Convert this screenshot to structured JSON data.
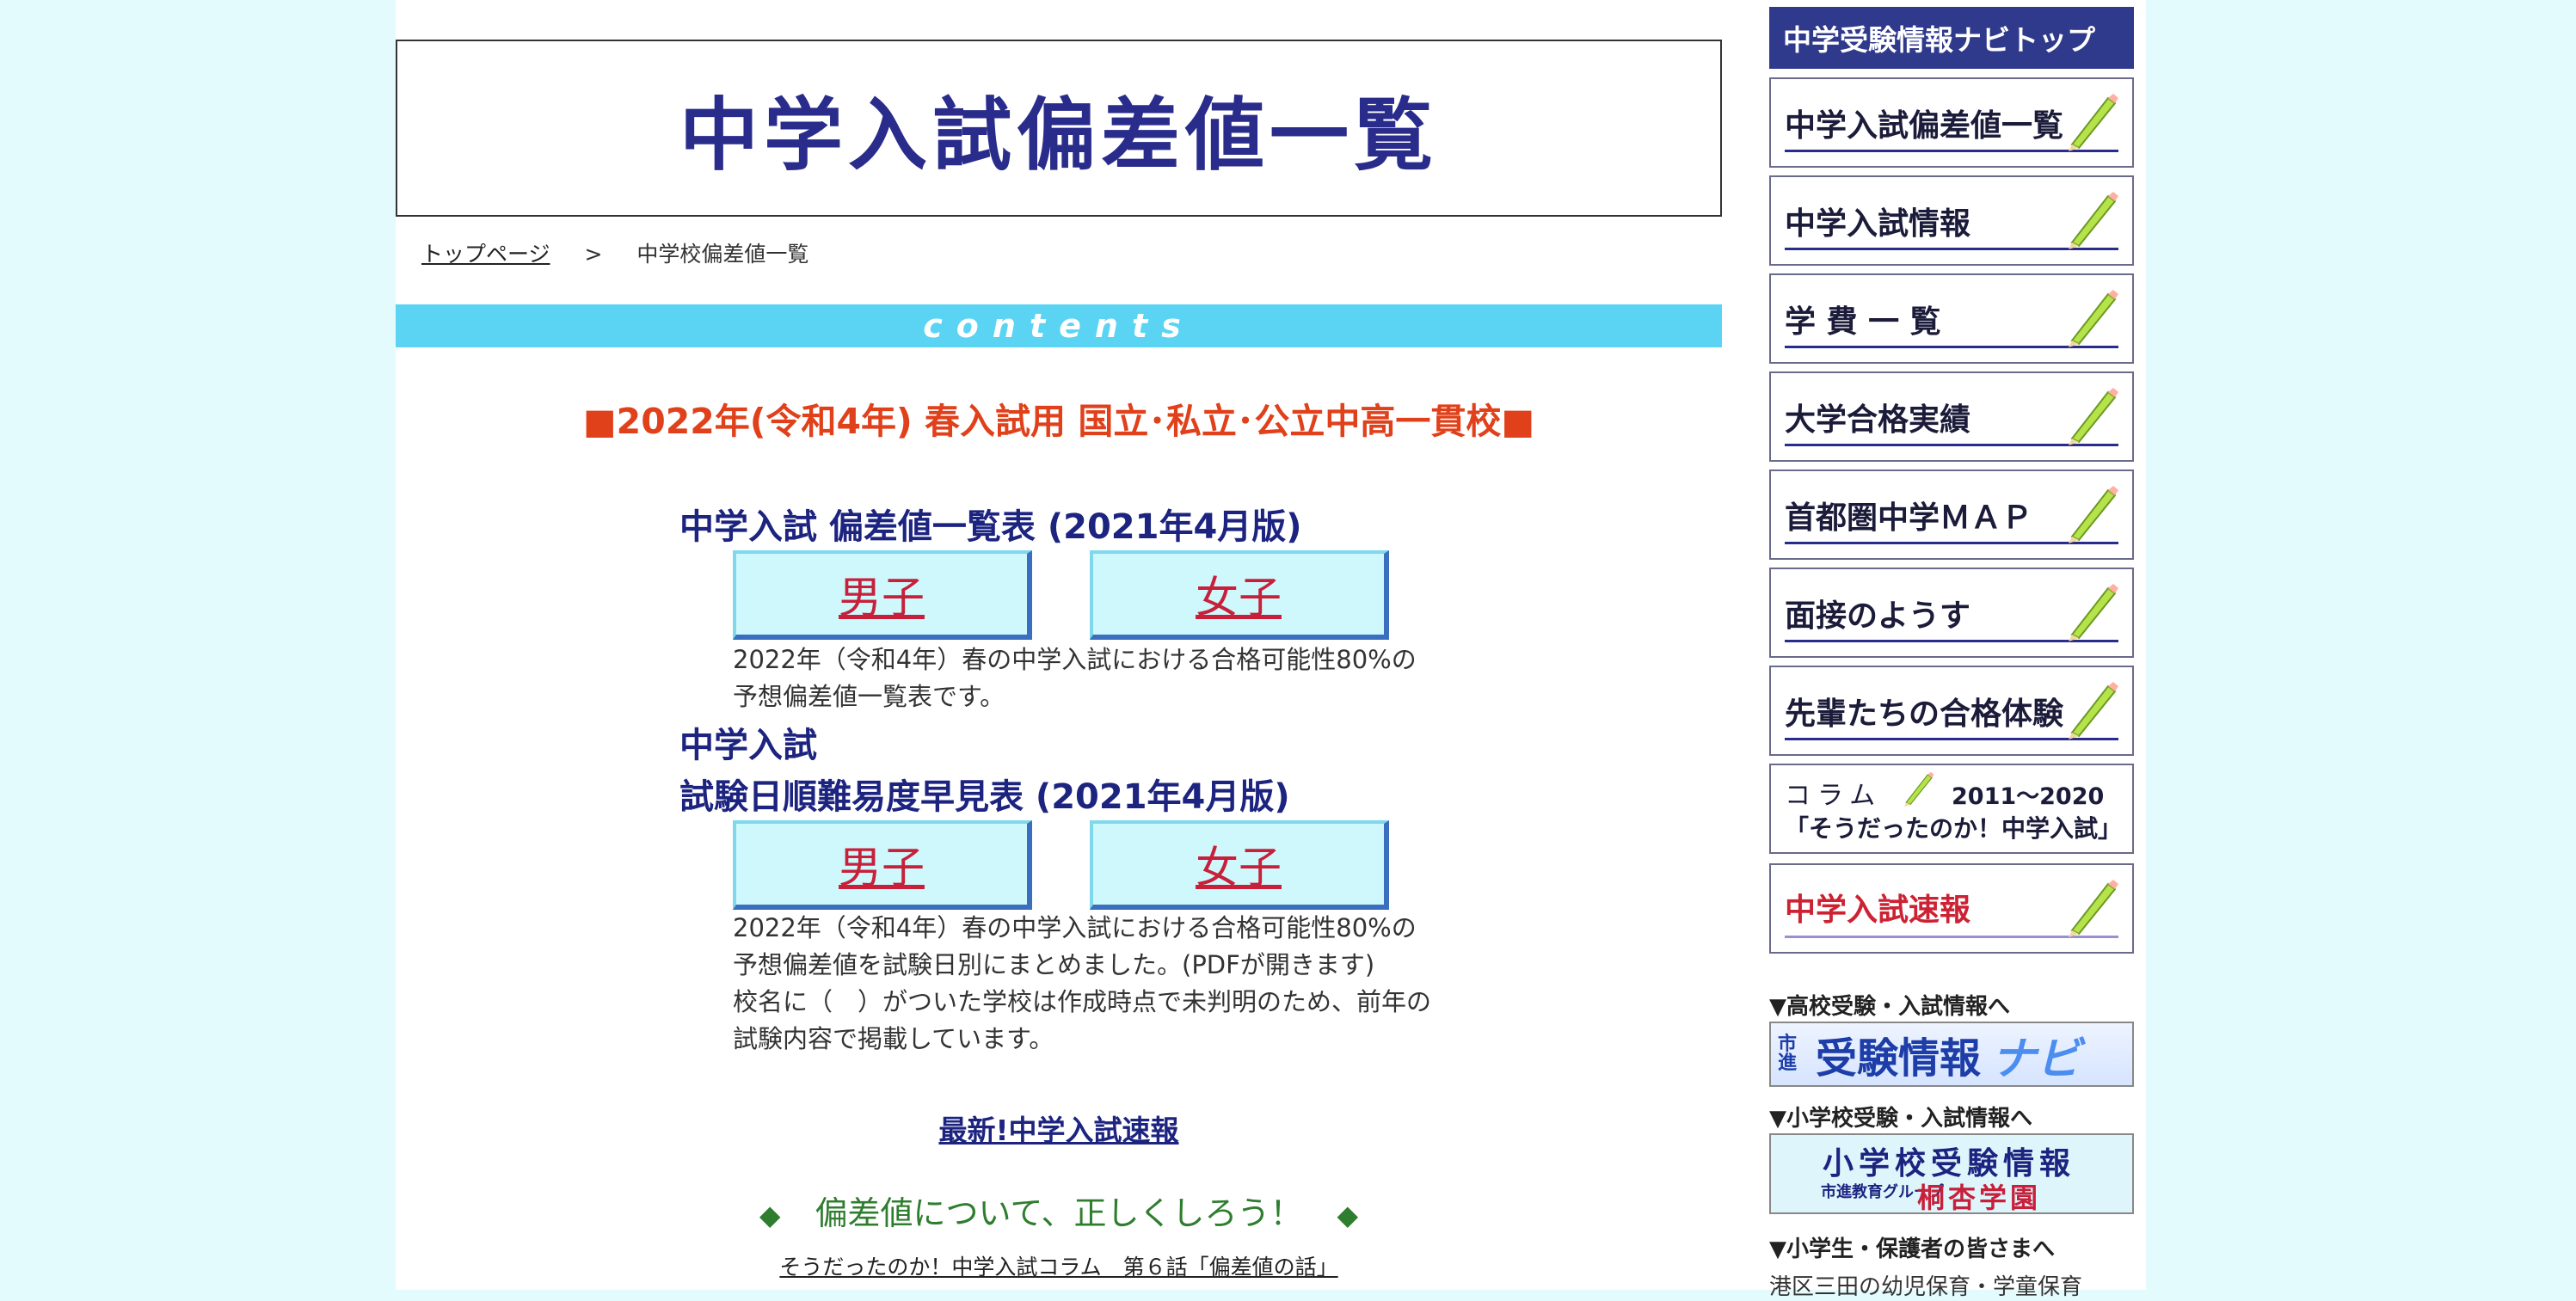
{
  "header": {
    "title": "中学入試偏差値一覧"
  },
  "breadcrumb": {
    "home": "トップページ",
    "separator": ">",
    "current": "中学校偏差値一覧"
  },
  "contents_label": "contents",
  "exam_title": "■2022年(令和4年) 春入試用 国立･私立･公立中高一貫校■",
  "section1": {
    "title": "中学入試 偏差値一覧表 (2021年4月版)",
    "boys": "男子",
    "girls": "女子",
    "note_line1": "2022年（令和4年）春の中学入試における合格可能性80%の",
    "note_line2": "予想偏差値一覧表です。"
  },
  "section2": {
    "title_line1": "中学入試",
    "title_line2": "試験日順難易度早見表 (2021年4月版)",
    "boys": "男子",
    "girls": "女子",
    "note_line1": "2022年（令和4年）春の中学入試における合格可能性80%の",
    "note_line2": "予想偏差値を試験日別にまとめました。(PDFが開きます)",
    "note_line3": "校名に（　）がついた学校は作成時点で未判明のため、前年の",
    "note_line4": "試験内容で掲載しています。"
  },
  "news_link": "最新!中学入試速報",
  "hensa": {
    "diamond": "◆",
    "heading": "偏差値について、正しくしろう！"
  },
  "column_link": "そうだったのか！中学入試コラム　第６話「偏差値の話」",
  "sidebar": {
    "top": "中学受験情報ナビトップ",
    "items": [
      {
        "label": "中学入試偏差値一覧"
      },
      {
        "label": "中学入試情報"
      },
      {
        "label": "学 費 一 覧"
      },
      {
        "label": "大学合格実績"
      },
      {
        "label": "首都圏中学ＭＡＰ"
      },
      {
        "label": "面接のようす"
      },
      {
        "label": "先輩たちの合格体験"
      }
    ],
    "column": {
      "top": "コラム",
      "years": "2011〜2020",
      "sub": "「そうだったのか！中学入試」"
    },
    "sokuho": "中学入試速報",
    "caption_koko": "▼高校受験・入試情報へ",
    "banner_koko": {
      "brand": "市進",
      "main": "受験情報",
      "navi": "ナビ"
    },
    "caption_sho": "▼小学校受験・入試情報へ",
    "banner_sho": {
      "t1": "小学校受験情報",
      "t2": "市進教育グループ",
      "t3": "桐杏学園"
    },
    "caption_parent": "▼小学生・保護者の皆さまへ",
    "parent_text": "港区三田の幼児保育・学童保育"
  },
  "colors": {
    "background": "#e3fbfd",
    "header_title": "#2a2c8c",
    "contents_bar": "#5bd4f4",
    "exam_title": "#e0401a",
    "section_title": "#1d2480",
    "button_text": "#c8203a",
    "sidebar_top": "#303a8c",
    "green": "#2f7d2f"
  }
}
